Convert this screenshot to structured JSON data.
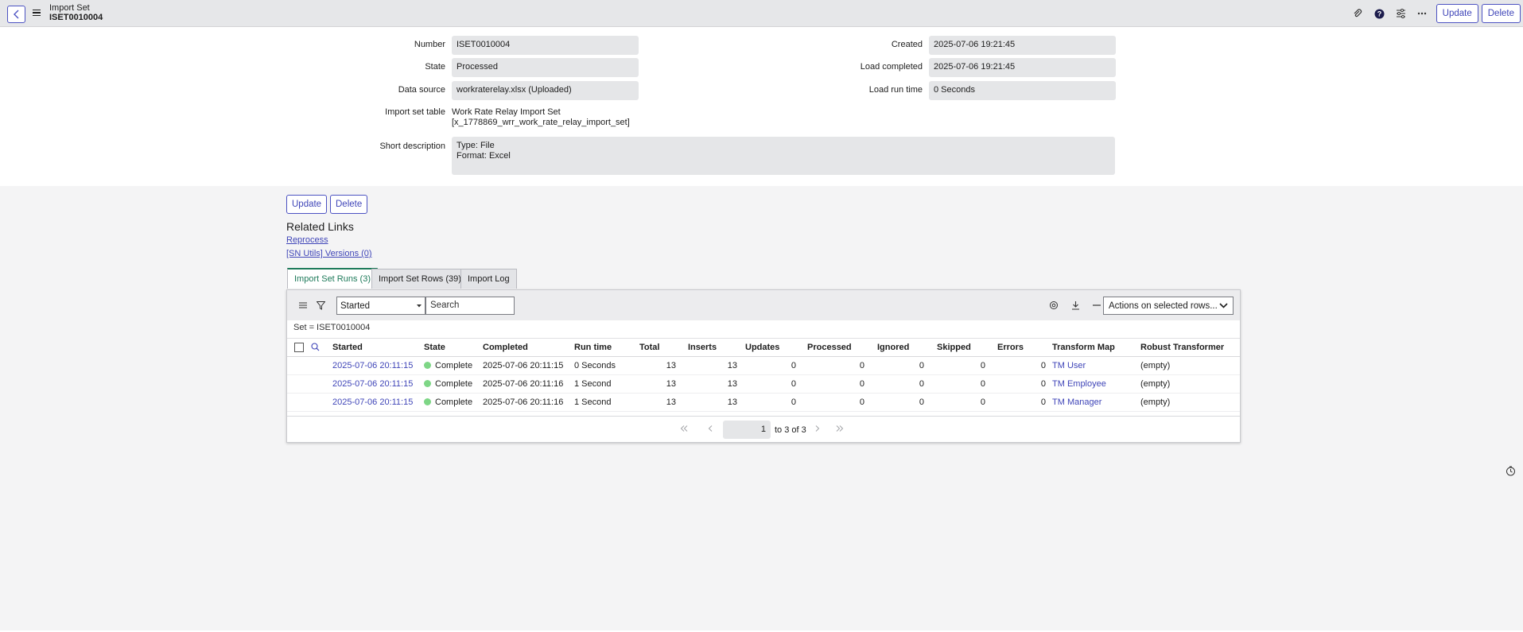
{
  "header": {
    "title_line1": "Import Set",
    "title_line2": "ISET0010004",
    "update_label": "Update",
    "delete_label": "Delete"
  },
  "form": {
    "number_label": "Number",
    "number_value": "ISET0010004",
    "state_label": "State",
    "state_value": "Processed",
    "data_source_label": "Data source",
    "data_source_value": "workraterelay.xlsx (Uploaded)",
    "import_set_table_label": "Import set table",
    "import_set_table_line1": "Work Rate Relay Import Set",
    "import_set_table_line2": "[x_1778869_wrr_work_rate_relay_import_set]",
    "short_description_label": "Short description",
    "short_description_line1": "Type: File",
    "short_description_line2": "Format: Excel",
    "created_label": "Created",
    "created_value": "2025-07-06 19:21:45",
    "load_completed_label": "Load completed",
    "load_completed_value": "2025-07-06 19:21:45",
    "load_run_time_label": "Load run time",
    "load_run_time_value": "0 Seconds"
  },
  "form_buttons": {
    "update_label": "Update",
    "delete_label": "Delete"
  },
  "related_links": {
    "title": "Related Links",
    "links": [
      "Reprocess",
      "[SN Utils] Versions (0)"
    ]
  },
  "tabs": [
    {
      "label": "Import Set Runs (3)",
      "active": true
    },
    {
      "label": "Import Set Rows (39)",
      "active": false
    },
    {
      "label": "Import Log",
      "active": false
    }
  ],
  "list": {
    "filter_field": "Started",
    "search_placeholder": "Search",
    "actions_label": "Actions on selected rows...",
    "breadcrumb": "Set = ISET0010004",
    "columns": [
      "Started",
      "State",
      "Completed",
      "Run time",
      "Total",
      "Inserts",
      "Updates",
      "Processed",
      "Ignored",
      "Skipped",
      "Errors",
      "Transform Map",
      "Robust Transformer"
    ],
    "rows": [
      {
        "started": "2025-07-06 20:11:15",
        "state": "Complete",
        "completed": "2025-07-06 20:11:15",
        "run_time": "0 Seconds",
        "total": "13",
        "inserts": "13",
        "updates": "0",
        "processed": "0",
        "ignored": "0",
        "skipped": "0",
        "errors": "0",
        "transform_map": "TM User",
        "robust": "(empty)"
      },
      {
        "started": "2025-07-06 20:11:15",
        "state": "Complete",
        "completed": "2025-07-06 20:11:16",
        "run_time": "1 Second",
        "total": "13",
        "inserts": "13",
        "updates": "0",
        "processed": "0",
        "ignored": "0",
        "skipped": "0",
        "errors": "0",
        "transform_map": "TM Employee",
        "robust": "(empty)"
      },
      {
        "started": "2025-07-06 20:11:15",
        "state": "Complete",
        "completed": "2025-07-06 20:11:16",
        "run_time": "1 Second",
        "total": "13",
        "inserts": "13",
        "updates": "0",
        "processed": "0",
        "ignored": "0",
        "skipped": "0",
        "errors": "0",
        "transform_map": "TM Manager",
        "robust": "(empty)"
      }
    ],
    "pager_value": "1",
    "pager_text": "to 3 of 3"
  },
  "colors": {
    "accent": "#4c52c2",
    "link": "#3f45b8",
    "active_tab": "#1e7a5a",
    "complete_dot": "#7ed686"
  }
}
